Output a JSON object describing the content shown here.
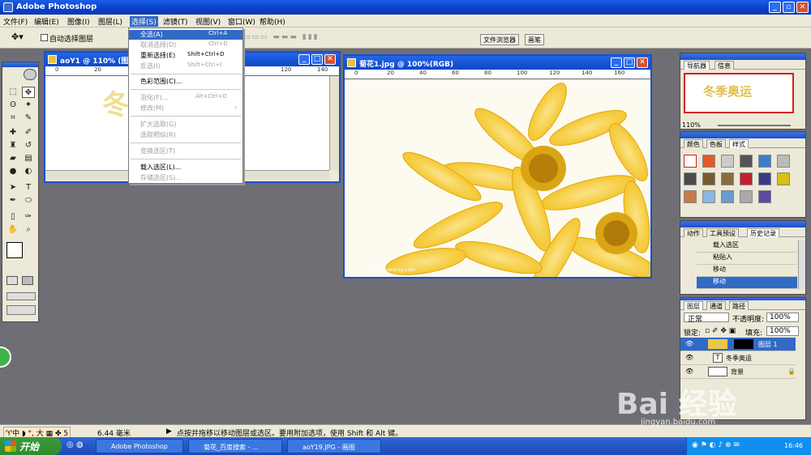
{
  "app": {
    "title": "Adobe Photoshop"
  },
  "menubar": [
    "文件(F)",
    "编辑(E)",
    "图像(I)",
    "图层(L)",
    "选择(S)",
    "滤镜(T)",
    "视图(V)",
    "窗口(W)",
    "帮助(H)"
  ],
  "options": {
    "auto_select": "自动选择图层",
    "file_browser": "文件浏览器",
    "brushes": "画笔"
  },
  "select_menu": [
    {
      "label": "全选(A)",
      "shortcut": "Ctrl+A",
      "state": "highlight"
    },
    {
      "label": "取消选择(D)",
      "shortcut": "Ctrl+D",
      "state": "disabled"
    },
    {
      "label": "重新选择(E)",
      "shortcut": "Shift+Ctrl+D",
      "state": "normal"
    },
    {
      "label": "反选(I)",
      "shortcut": "Shift+Ctrl+I",
      "state": "disabled"
    },
    {
      "label": "色彩范围(C)...",
      "shortcut": "",
      "state": "normal"
    },
    {
      "label": "羽化(F)...",
      "shortcut": "Alt+Ctrl+D",
      "state": "disabled"
    },
    {
      "label": "修改(M)",
      "shortcut": "",
      "state": "disabled"
    },
    {
      "label": "扩大选取(G)",
      "shortcut": "",
      "state": "disabled"
    },
    {
      "label": "选取相似(R)",
      "shortcut": "",
      "state": "disabled"
    },
    {
      "label": "变换选区(T)",
      "shortcut": "",
      "state": "disabled"
    },
    {
      "label": "载入选区(L)...",
      "shortcut": "",
      "state": "normal"
    },
    {
      "label": "存储选区(S)...",
      "shortcut": "",
      "state": "disabled"
    }
  ],
  "doc1": {
    "title": "aoY1 @ 110% (图",
    "artwork_text": "冬季奥运",
    "ruler": [
      "0",
      "20",
      "120",
      "140"
    ]
  },
  "doc2": {
    "title": "菊花1.jpg @ 100%(RGB)",
    "ruler": [
      "0",
      "20",
      "40",
      "60",
      "80",
      "100",
      "120",
      "140",
      "160"
    ],
    "watermark": "www.quanjing.com"
  },
  "navigator": {
    "tabs": [
      "导航器",
      "信息"
    ],
    "zoom": "110%",
    "preview_text": "冬季奥运"
  },
  "styles_palette": {
    "tabs": [
      "颜色",
      "色板",
      "样式"
    ]
  },
  "history": {
    "tabs": [
      "动作",
      "工具预设",
      "历史记录"
    ],
    "items": [
      "载入选区",
      "粘贴入",
      "移动",
      "移动"
    ]
  },
  "layers": {
    "tabs": [
      "图层",
      "通道",
      "路径"
    ],
    "blend_mode": "正常",
    "opacity_label": "不透明度:",
    "opacity": "100%",
    "lock_label": "锁定:",
    "fill_label": "填充:",
    "fill": "100%",
    "items": [
      "图层 1",
      "冬季奥运",
      "背景"
    ]
  },
  "status": {
    "zoom": "6.44 毫米",
    "hint": "点按并拖移以移动图层或选区。要用附加选项，使用 Shift 和 Alt 键。"
  },
  "taskbar": {
    "start": "开始",
    "tasks": [
      "Adobe Photoshop",
      "菊花_百度搜索 - ...",
      "aoY19.JPG - 画图"
    ],
    "clock": "16:46"
  },
  "watermark": {
    "brand": "Bai 经验",
    "url": "jingyan.baidu.com"
  }
}
